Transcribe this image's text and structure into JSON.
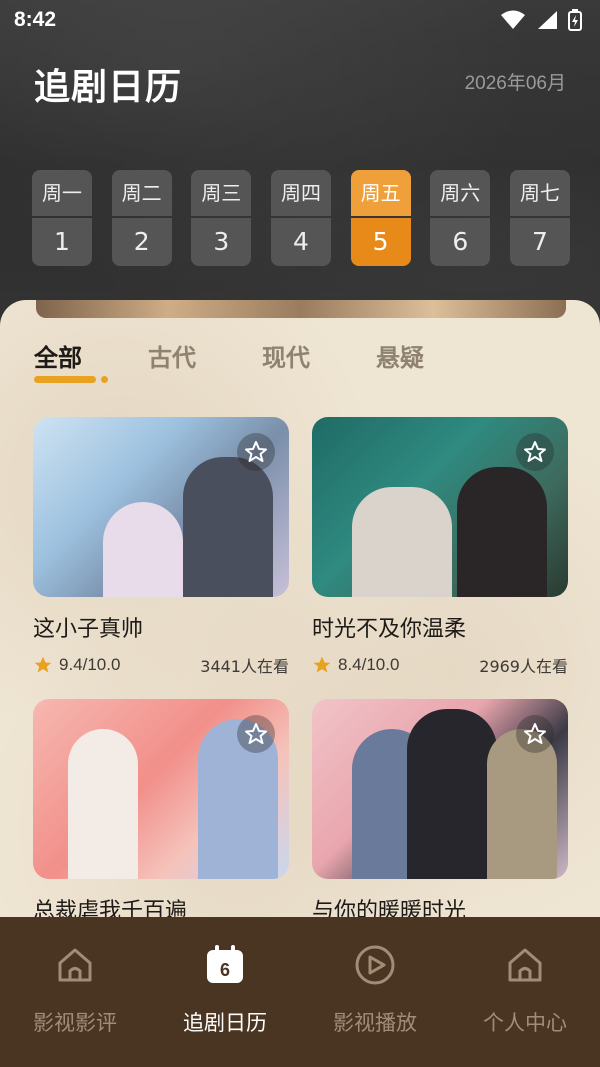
{
  "status": {
    "time": "8:42"
  },
  "header": {
    "title": "追剧日历",
    "month": "2026年06月"
  },
  "week": [
    {
      "weekday": "周一",
      "date": "1",
      "active": false
    },
    {
      "weekday": "周二",
      "date": "2",
      "active": false
    },
    {
      "weekday": "周三",
      "date": "3",
      "active": false
    },
    {
      "weekday": "周四",
      "date": "4",
      "active": false
    },
    {
      "weekday": "周五",
      "date": "5",
      "active": true
    },
    {
      "weekday": "周六",
      "date": "6",
      "active": false
    },
    {
      "weekday": "周七",
      "date": "7",
      "active": false
    }
  ],
  "tabs": [
    {
      "label": "全部",
      "active": true
    },
    {
      "label": "古代",
      "active": false
    },
    {
      "label": "现代",
      "active": false
    },
    {
      "label": "悬疑",
      "active": false
    }
  ],
  "shows": [
    {
      "title": "这小子真帅",
      "rating": "9.4/10.0",
      "watchers": "3441人在看"
    },
    {
      "title": "时光不及你温柔",
      "rating": "8.4/10.0",
      "watchers": "2969人在看"
    },
    {
      "title": "总裁虐我千百遍",
      "rating": "",
      "watchers": ""
    },
    {
      "title": "与你的暖暖时光",
      "rating": "",
      "watchers": ""
    }
  ],
  "nav": [
    {
      "label": "影视影评",
      "icon": "home-icon",
      "active": false
    },
    {
      "label": "追剧日历",
      "icon": "calendar-icon",
      "active": true,
      "badge": "6"
    },
    {
      "label": "影视播放",
      "icon": "play-icon",
      "active": false
    },
    {
      "label": "个人中心",
      "icon": "home-icon",
      "active": false
    }
  ],
  "colors": {
    "accent": "#e88a1a",
    "nav_bg": "#4a3422",
    "panel_bg": "#efe5d3",
    "star": "#e8a21f"
  }
}
